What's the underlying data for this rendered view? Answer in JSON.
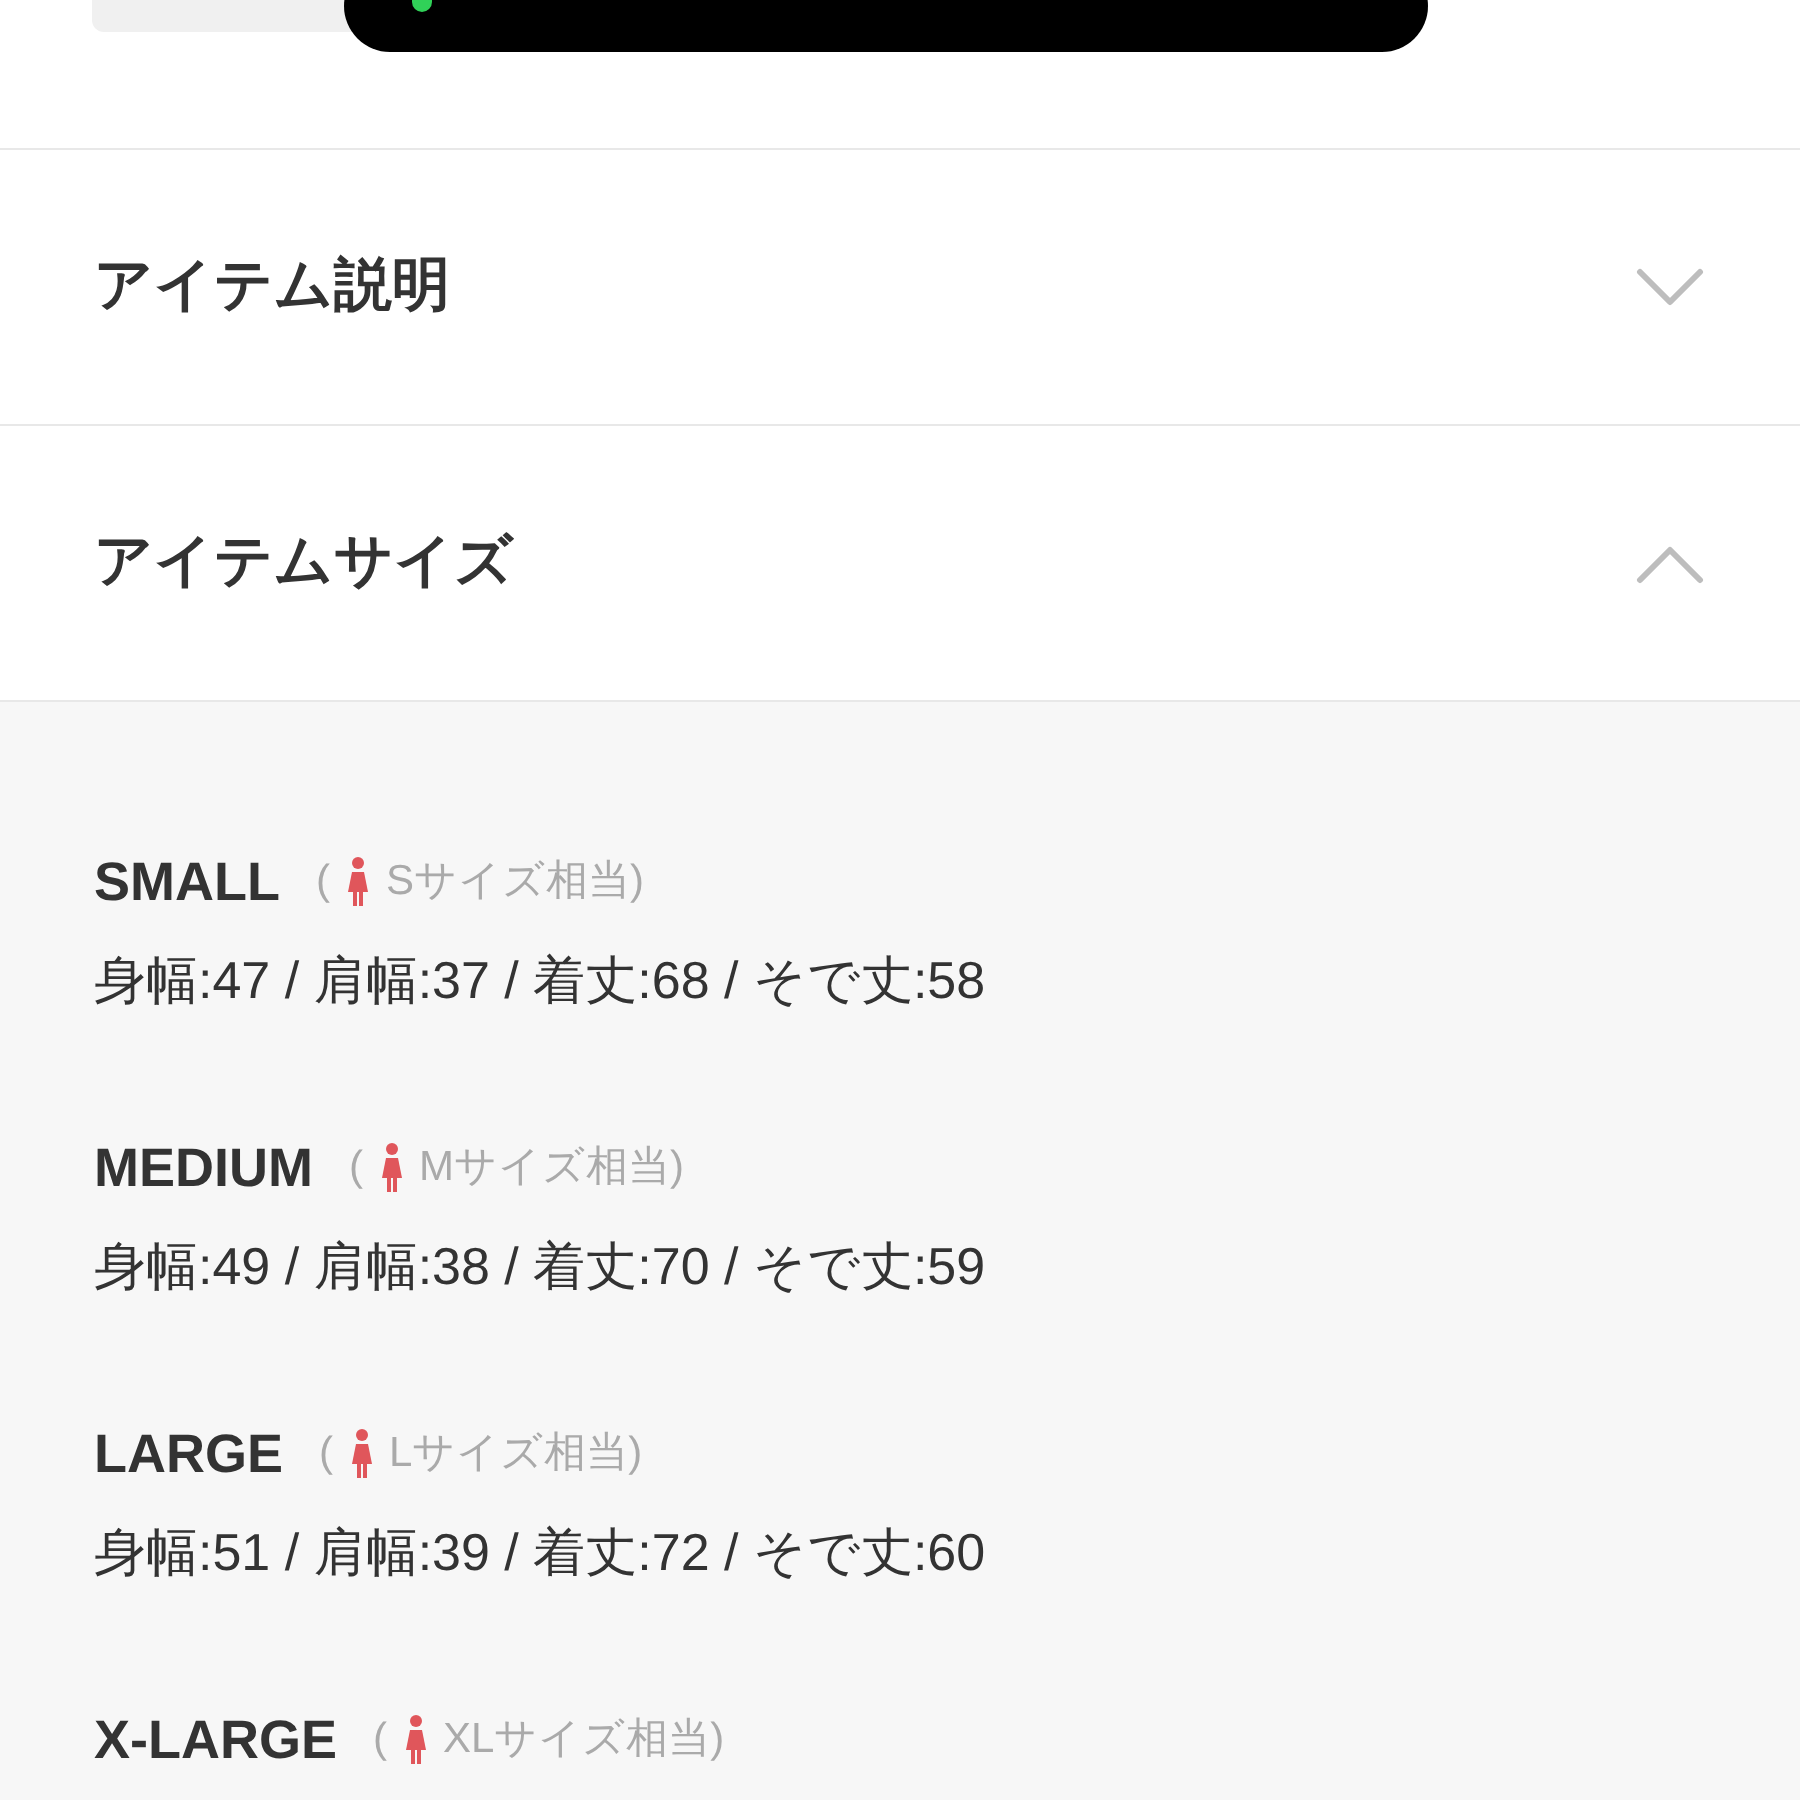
{
  "sections": [
    {
      "title": "アイテム説明",
      "expanded": false
    },
    {
      "title": "アイテムサイズ",
      "expanded": true
    }
  ],
  "sizes": [
    {
      "name": "SMALL",
      "open_paren": "(",
      "equivalent": "Sサイズ相当)",
      "measurements": "身幅:47 / 肩幅:37 / 着丈:68 / そで丈:58"
    },
    {
      "name": "MEDIUM",
      "open_paren": "(",
      "equivalent": "Mサイズ相当)",
      "measurements": "身幅:49 / 肩幅:38 / 着丈:70 / そで丈:59"
    },
    {
      "name": "LARGE",
      "open_paren": "(",
      "equivalent": "Lサイズ相当)",
      "measurements": "身幅:51 / 肩幅:39 / 着丈:72 / そで丈:60"
    },
    {
      "name": "X-LARGE",
      "open_paren": "(",
      "equivalent": "XLサイズ相当)"
    }
  ]
}
